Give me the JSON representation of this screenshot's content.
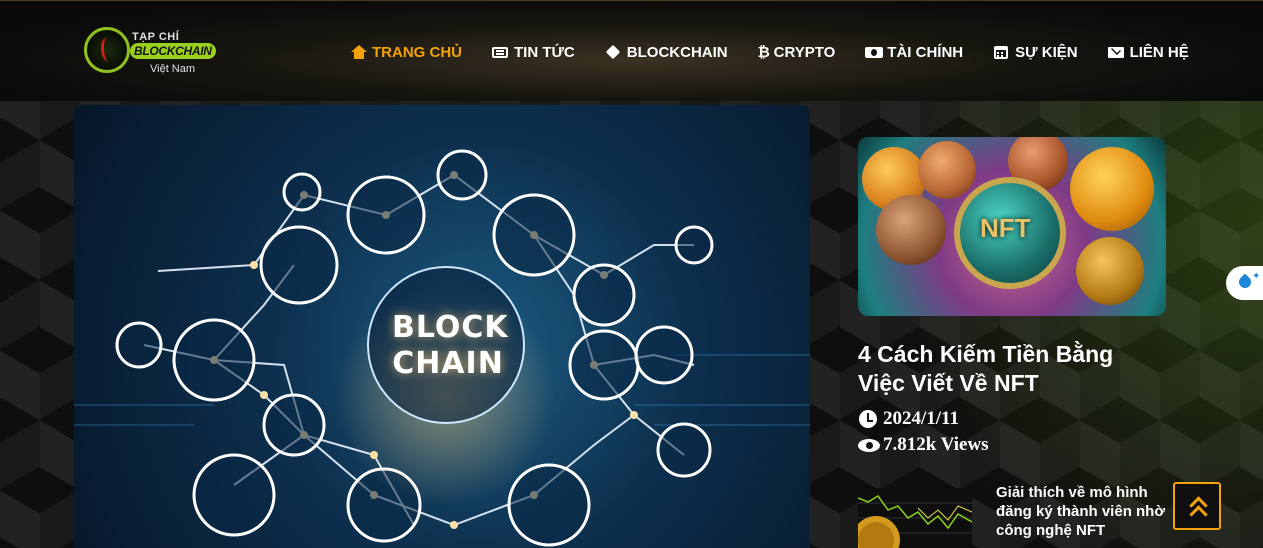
{
  "site": {
    "logo": {
      "line1": "TẠP CHÍ",
      "line2": "BLOCKCHAIN",
      "line3": "Việt Nam"
    }
  },
  "nav": {
    "items": [
      {
        "label": "TRANG CHỦ",
        "icon": "home-icon",
        "active": true
      },
      {
        "label": "TIN TỨC",
        "icon": "newspaper-icon",
        "active": false
      },
      {
        "label": "BLOCKCHAIN",
        "icon": "cube-icon",
        "active": false
      },
      {
        "label": "CRYPTO",
        "icon": "bitcoin-icon",
        "active": false
      },
      {
        "label": "TÀI CHÍNH",
        "icon": "money-icon",
        "active": false
      },
      {
        "label": "SỰ KIỆN",
        "icon": "calendar-icon",
        "active": false
      },
      {
        "label": "LIÊN HỆ",
        "icon": "envelope-icon",
        "active": false
      }
    ]
  },
  "hero": {
    "center_text_line1": "BLOCK",
    "center_text_line2": "CHAIN"
  },
  "side_article": {
    "image_text": "NFT",
    "title": "4 Cách Kiếm Tiền Bằng Việc Viết Về NFT",
    "date": "2024/1/11",
    "views": "7.812k Views"
  },
  "related": {
    "title": "Giải thích về mô hình đăng ký thành viên nhờ công nghệ NFT"
  },
  "colors": {
    "accent": "#f4a20c",
    "logo_green": "#9ad01e",
    "background": "#141414"
  },
  "widgets": {
    "scroll_top_icon": "double-chevron-up-icon",
    "dark_mode_icon": "water-drop-icon"
  }
}
